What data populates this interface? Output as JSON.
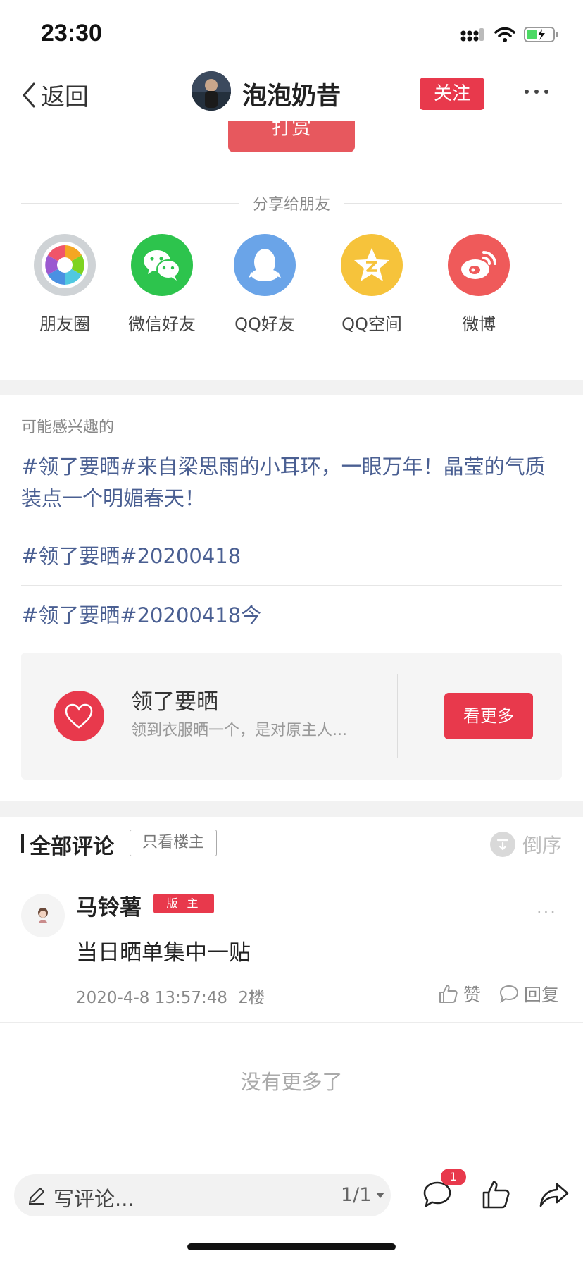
{
  "status_bar": {
    "time": "23:30"
  },
  "nav": {
    "back_label": "返回",
    "title": "泡泡奶昔",
    "follow_label": "关注"
  },
  "reward": {
    "label": "打赏"
  },
  "share": {
    "header": "分享给朋友",
    "items": [
      {
        "label": "朋友圈",
        "icon": "moments-icon",
        "color": "#cfd3d6"
      },
      {
        "label": "微信好友",
        "icon": "wechat-icon",
        "color": "#2dc44d"
      },
      {
        "label": "QQ好友",
        "icon": "qq-icon",
        "color": "#6aa4e8"
      },
      {
        "label": "QQ空间",
        "icon": "qzone-icon",
        "color": "#f6c33b"
      },
      {
        "label": "微博",
        "icon": "weibo-icon",
        "color": "#ef5a5a"
      }
    ]
  },
  "interest": {
    "heading": "可能感兴趣的",
    "links": [
      "#领了要晒#来自梁思雨的小耳环，一眼万年！晶莹的气质装点一个明媚春天！",
      "#领了要晒#20200418",
      "#领了要晒#20200418今"
    ]
  },
  "topic": {
    "title": "领了要晒",
    "desc": "领到衣服晒一个，是对原主人...",
    "button": "看更多"
  },
  "comments": {
    "title": "全部评论",
    "only_op": "只看楼主",
    "sort_label": "倒序",
    "items": [
      {
        "user": "马铃薯",
        "badge": "版 主",
        "menu": "···",
        "body": "当日晒单集中一贴",
        "time": "2020-4-8 13:57:48",
        "floor": "2楼",
        "like_label": "赞",
        "reply_label": "回复"
      }
    ],
    "no_more": "没有更多了"
  },
  "bottom_bar": {
    "input_placeholder": "写评论...",
    "page": "1/1",
    "comment_count": "1"
  },
  "colors": {
    "accent": "#e8394c",
    "link": "#4a5f92"
  }
}
